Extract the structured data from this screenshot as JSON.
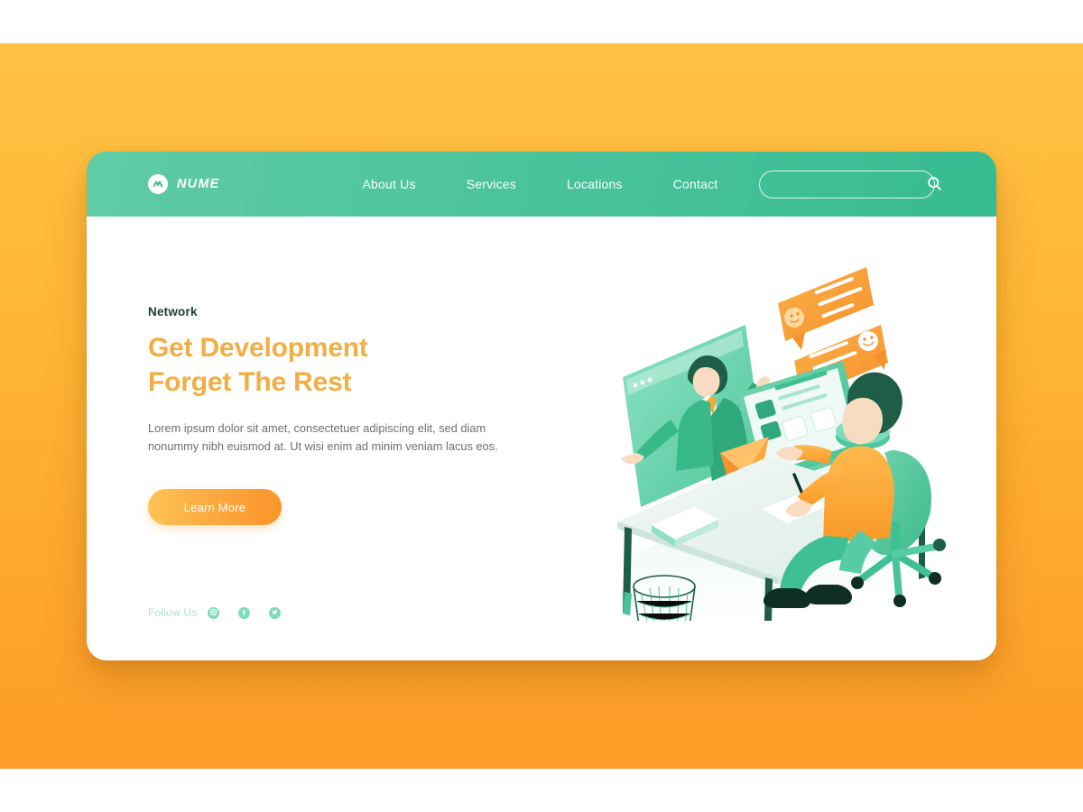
{
  "page": {
    "background_color_top": "#FFC243",
    "background_color_bottom": "#FD9C27",
    "card_background": "#FFFFFF"
  },
  "navbar": {
    "background_gradient_from": "#5FCCA4",
    "background_gradient_to": "#37BB90",
    "brand": {
      "name": "NUME",
      "mark_icon": "wave-mark-icon",
      "mark_color": "#3BBE94"
    },
    "links": [
      {
        "label": "About Us"
      },
      {
        "label": "Services"
      },
      {
        "label": "Locations"
      },
      {
        "label": "Contact"
      }
    ],
    "search": {
      "value": "",
      "placeholder": "",
      "icon": "search-icon"
    }
  },
  "hero": {
    "eyebrow": "Network",
    "headline_line1": "Get Development",
    "headline_line2": "Forget The Rest",
    "headline_color": "#F2AE45",
    "paragraph": "Lorem ipsum dolor sit amet, consectetuer adipiscing elit, sed diam nonummy nibh euismod at. Ut wisi enim ad minim veniam lacus eos.",
    "cta_label": "Learn More",
    "cta_color_from": "#FDC457",
    "cta_color_to": "#F9952B"
  },
  "follow": {
    "label": "Follow Us",
    "label_color": "#A9E5CD",
    "icon_background": "#7FDCBA",
    "items": [
      {
        "icon": "instagram-icon",
        "name": "Instagram"
      },
      {
        "icon": "facebook-icon",
        "name": "Facebook"
      },
      {
        "icon": "twitter-icon",
        "name": "Twitter"
      }
    ]
  },
  "illustration": {
    "name": "video-call-workspace-illustration",
    "description": "Isometric desk scene: a man in an orange shirt seated in a green office chair at a white desk with a green laptop, coffee cup, notebook and pen; a video call window shows a man in a green suit with orange tie; orange chat bubbles float above; a mesh wastebasket sits under the desk.",
    "palette": {
      "green_dark": "#1E5E46",
      "green_mid": "#3FBF94",
      "green_light": "#8FE0C2",
      "orange": "#F9A03A",
      "orange_light": "#FFC06A",
      "desk": "#E8F2ED",
      "skin": "#F6D9C0"
    }
  }
}
